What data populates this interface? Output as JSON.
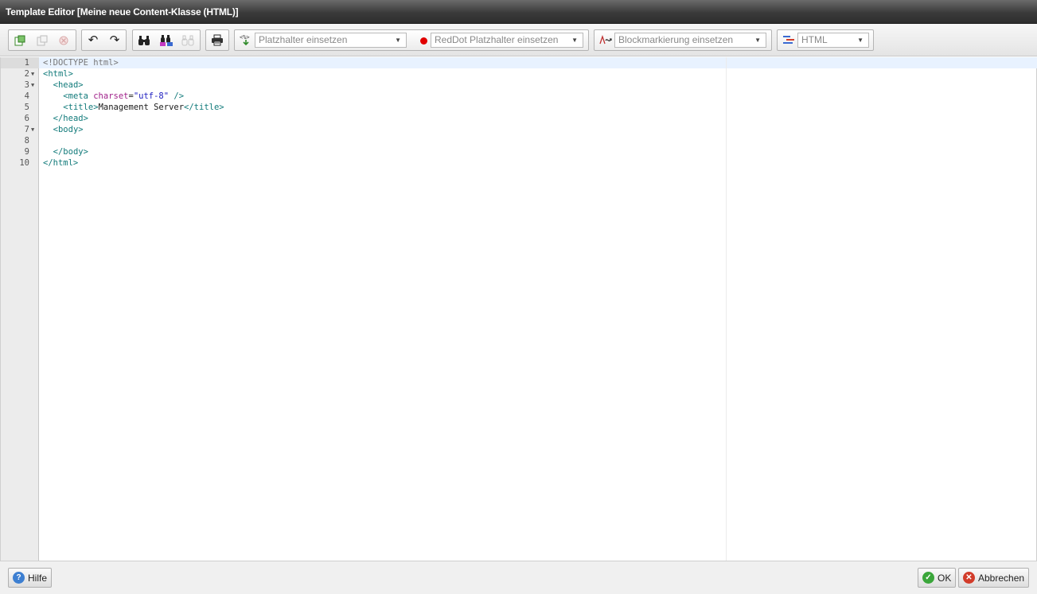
{
  "window": {
    "title": "Template Editor [Meine neue Content-Klasse (HTML)]"
  },
  "toolbar": {
    "file_buttons": [
      "new-icon",
      "copy-icon",
      "delete-icon"
    ],
    "history_buttons": [
      "undo-icon",
      "redo-icon"
    ],
    "search_buttons": [
      "find-icon",
      "replace-icon",
      "find-next-icon"
    ],
    "print_button": "print-icon",
    "placeholder_select": "Platzhalter einsetzen",
    "reddot_select": "RedDot Platzhalter einsetzen",
    "block_select": "Blockmarkierung einsetzen",
    "mode_select": "HTML",
    "reddot_color": "#e10000"
  },
  "editor": {
    "lines": [
      {
        "number": "1",
        "fold": false,
        "tokens": [
          {
            "t": "doc",
            "v": "<!DOCTYPE html>"
          }
        ]
      },
      {
        "number": "2",
        "fold": true,
        "tokens": [
          {
            "t": "tag",
            "v": "<html>"
          }
        ]
      },
      {
        "number": "3",
        "fold": true,
        "tokens": [
          {
            "t": "txt",
            "v": "  "
          },
          {
            "t": "tag",
            "v": "<head>"
          }
        ]
      },
      {
        "number": "4",
        "fold": false,
        "tokens": [
          {
            "t": "txt",
            "v": "    "
          },
          {
            "t": "tag",
            "v": "<meta "
          },
          {
            "t": "attr",
            "v": "charset"
          },
          {
            "t": "txt",
            "v": "="
          },
          {
            "t": "str",
            "v": "\"utf-8\""
          },
          {
            "t": "tag",
            "v": " />"
          }
        ]
      },
      {
        "number": "5",
        "fold": false,
        "tokens": [
          {
            "t": "txt",
            "v": "    "
          },
          {
            "t": "tag",
            "v": "<title>"
          },
          {
            "t": "txt",
            "v": "Management Server"
          },
          {
            "t": "tag",
            "v": "</title>"
          }
        ]
      },
      {
        "number": "6",
        "fold": false,
        "tokens": [
          {
            "t": "txt",
            "v": "  "
          },
          {
            "t": "tag",
            "v": "</head>"
          }
        ]
      },
      {
        "number": "7",
        "fold": true,
        "tokens": [
          {
            "t": "txt",
            "v": "  "
          },
          {
            "t": "tag",
            "v": "<body>"
          }
        ]
      },
      {
        "number": "8",
        "fold": false,
        "tokens": []
      },
      {
        "number": "9",
        "fold": false,
        "tokens": [
          {
            "t": "txt",
            "v": "  "
          },
          {
            "t": "tag",
            "v": "</body>"
          }
        ]
      },
      {
        "number": "10",
        "fold": false,
        "tokens": [
          {
            "t": "tag",
            "v": "</html>"
          }
        ]
      }
    ]
  },
  "footer": {
    "help_label": "Hilfe",
    "ok_label": "OK",
    "cancel_label": "Abbrechen",
    "colors": {
      "help": "#3d7fd1",
      "ok": "#3aa63a",
      "cancel": "#d23c2a"
    }
  }
}
